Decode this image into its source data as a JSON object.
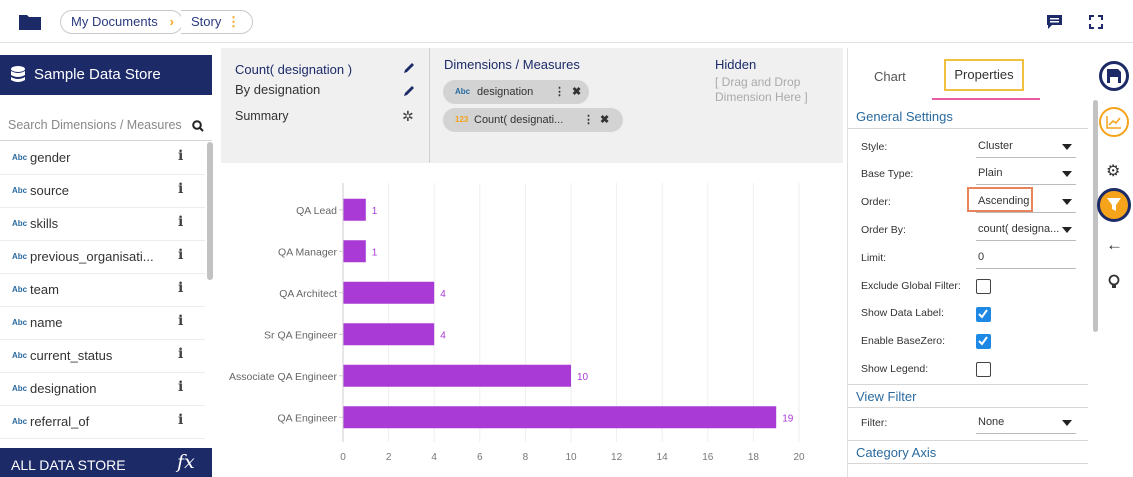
{
  "breadcrumb": {
    "root": "My Documents",
    "current": "Story"
  },
  "data_store": {
    "title": "Sample Data Store",
    "search_placeholder": "Search Dimensions / Measures",
    "footer": "ALL DATA STORE",
    "footer_icon": "fx"
  },
  "fields": [
    {
      "type": "Abc",
      "name": "gender"
    },
    {
      "type": "Abc",
      "name": "source"
    },
    {
      "type": "Abc",
      "name": "skills"
    },
    {
      "type": "Abc",
      "name": "previous_organisati..."
    },
    {
      "type": "Abc",
      "name": "team"
    },
    {
      "type": "Abc",
      "name": "name"
    },
    {
      "type": "Abc",
      "name": "current_status"
    },
    {
      "type": "Abc",
      "name": "designation"
    },
    {
      "type": "Abc",
      "name": "referral_of"
    }
  ],
  "measures_panel": {
    "title": "Count( designation )",
    "by": "By designation",
    "summary": "Summary"
  },
  "dimensions_panel": {
    "title": "Dimensions / Measures",
    "pill1_type": "Abc",
    "pill1": "designation",
    "pill2_type": "123",
    "pill2": "Count( designati..."
  },
  "hidden_panel": {
    "title": "Hidden",
    "drop1": "[ Drag and Drop",
    "drop2": "Dimension Here ]"
  },
  "tabs": {
    "chart": "Chart",
    "properties": "Properties"
  },
  "general": {
    "title": "General Settings",
    "style_label": "Style:",
    "style_value": "Cluster",
    "base_label": "Base Type:",
    "base_value": "Plain",
    "order_label": "Order:",
    "order_value": "Ascending",
    "orderby_label": "Order By:",
    "orderby_value": "count( designa...",
    "limit_label": "Limit:",
    "limit_value": "0",
    "exclude_label": "Exclude Global Filter:",
    "datalabel_label": "Show Data Label:",
    "basezero_label": "Enable BaseZero:",
    "legend_label": "Show Legend:"
  },
  "view_filter": {
    "title": "View Filter",
    "filter_label": "Filter:",
    "filter_value": "None"
  },
  "category_axis": {
    "title": "Category Axis"
  },
  "colors": {
    "navy": "#1c2a68",
    "bar": "#a93ad6",
    "accent_orange": "#f5a31a",
    "link_blue": "#2a6a9f",
    "highlight_pink": "#e85ca5"
  },
  "chart_data": {
    "type": "bar",
    "orientation": "horizontal",
    "categories": [
      "QA Lead",
      "QA Manager",
      "QA Architect",
      "Sr QA Engineer",
      "Associate QA Engineer",
      "QA Engineer"
    ],
    "values": [
      1,
      1,
      4,
      4,
      10,
      19
    ],
    "xticks": [
      0,
      2,
      4,
      6,
      8,
      10,
      12,
      14,
      16,
      18,
      20
    ],
    "xlim": [
      0,
      20
    ],
    "show_data_labels": true,
    "grid": true
  }
}
